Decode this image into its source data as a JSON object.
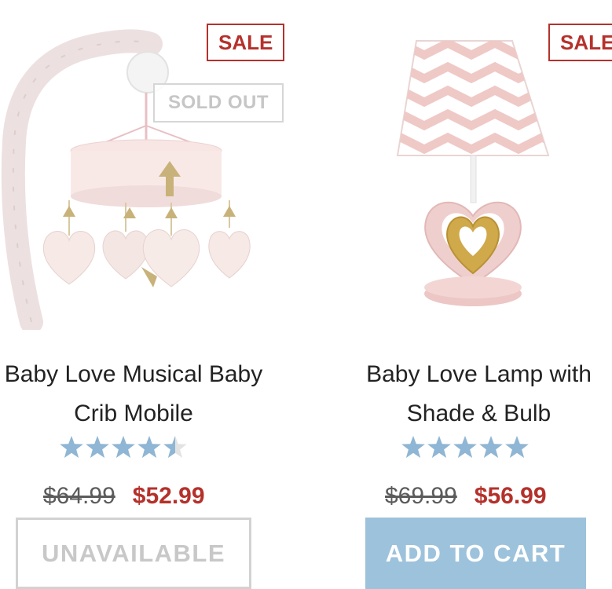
{
  "products": [
    {
      "title_line1": "Baby Love Musical Baby",
      "title_line2": "Crib Mobile",
      "sale_badge": "SALE",
      "status_badge": "SOLD OUT",
      "rating": 4.5,
      "rating_max": 5,
      "price_original": "$64.99",
      "price_sale": "$52.99",
      "button_label": "UNAVAILABLE",
      "button_enabled": false
    },
    {
      "title_line1": "Baby Love Lamp with",
      "title_line2": "Shade & Bulb",
      "sale_badge": "SALE",
      "rating": 5,
      "rating_max": 5,
      "price_original": "$69.99",
      "price_sale": "$56.99",
      "button_label": "ADD TO CART",
      "button_enabled": true
    }
  ],
  "colors": {
    "sale_red": "#b5312b",
    "star_blue": "#8fb6d4",
    "button_blue": "#9dc2dc",
    "disabled_gray": "#c8c8c8"
  },
  "icons": {
    "rating": "star-icon",
    "product_0_image": "crib-mobile-image",
    "product_1_image": "heart-lamp-image"
  }
}
